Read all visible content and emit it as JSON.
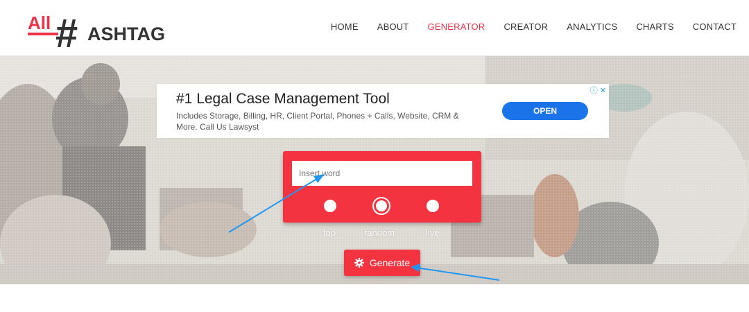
{
  "logo": {
    "all_text": "All",
    "hash": "#",
    "rest_text": "ASHTAG",
    "colors": {
      "all": "#ee3348",
      "dark": "#333333"
    }
  },
  "nav": {
    "items": [
      {
        "label": "HOME",
        "active": false
      },
      {
        "label": "ABOUT",
        "active": false
      },
      {
        "label": "GENERATOR",
        "active": true
      },
      {
        "label": "CREATOR",
        "active": false
      },
      {
        "label": "ANALYTICS",
        "active": false
      },
      {
        "label": "CHARTS",
        "active": false
      },
      {
        "label": "CONTACT",
        "active": false
      }
    ]
  },
  "ad": {
    "title": "#1 Legal Case Management Tool",
    "description": "Includes Storage, Billing, HR, Client Portal, Phones + Calls, Website, CRM & More. Call Us Lawsyst",
    "open_label": "OPEN",
    "icons": [
      "adchoices-icon",
      "close-icon"
    ]
  },
  "generator": {
    "input_placeholder": "Insert word",
    "options": [
      {
        "label": "top",
        "selected": false
      },
      {
        "label": "random",
        "selected": true
      },
      {
        "label": "live",
        "selected": false
      }
    ],
    "button_label": "Generate",
    "button_icon": "gear-icon"
  },
  "colors": {
    "accent": "#f3333f",
    "ad_button": "#1a73e8",
    "arrow": "#2196f3"
  }
}
